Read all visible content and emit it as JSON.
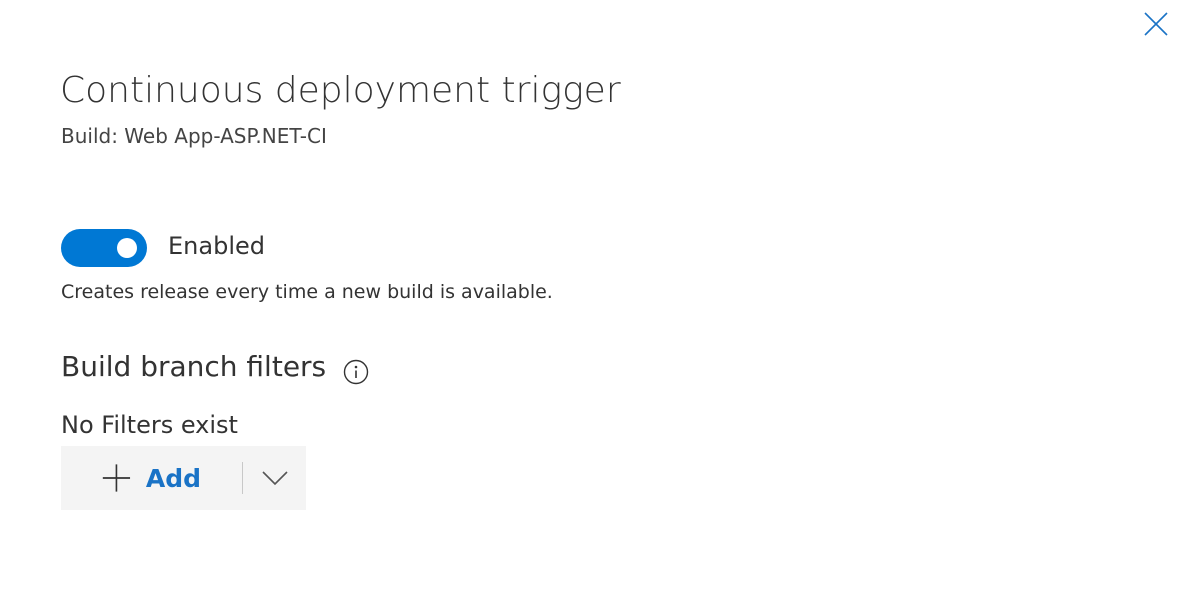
{
  "dialog": {
    "title": "Continuous deployment trigger",
    "subtitle": "Build: Web App-ASP.NET-CI",
    "close_icon": "close-icon"
  },
  "trigger": {
    "toggle_state": "on",
    "toggle_label": "Enabled",
    "description": "Creates release every time a new build is available."
  },
  "branch_filters": {
    "heading": "Build branch filters",
    "info_icon": "info-icon",
    "empty_text": "No Filters exist",
    "add_label": "Add",
    "add_icon": "plus-icon",
    "dropdown_icon": "chevron-down-icon"
  },
  "colors": {
    "toggle_on": "#0078d4",
    "link_blue": "#1a73c6",
    "button_bg": "#f4f4f4",
    "text": "#333333"
  }
}
